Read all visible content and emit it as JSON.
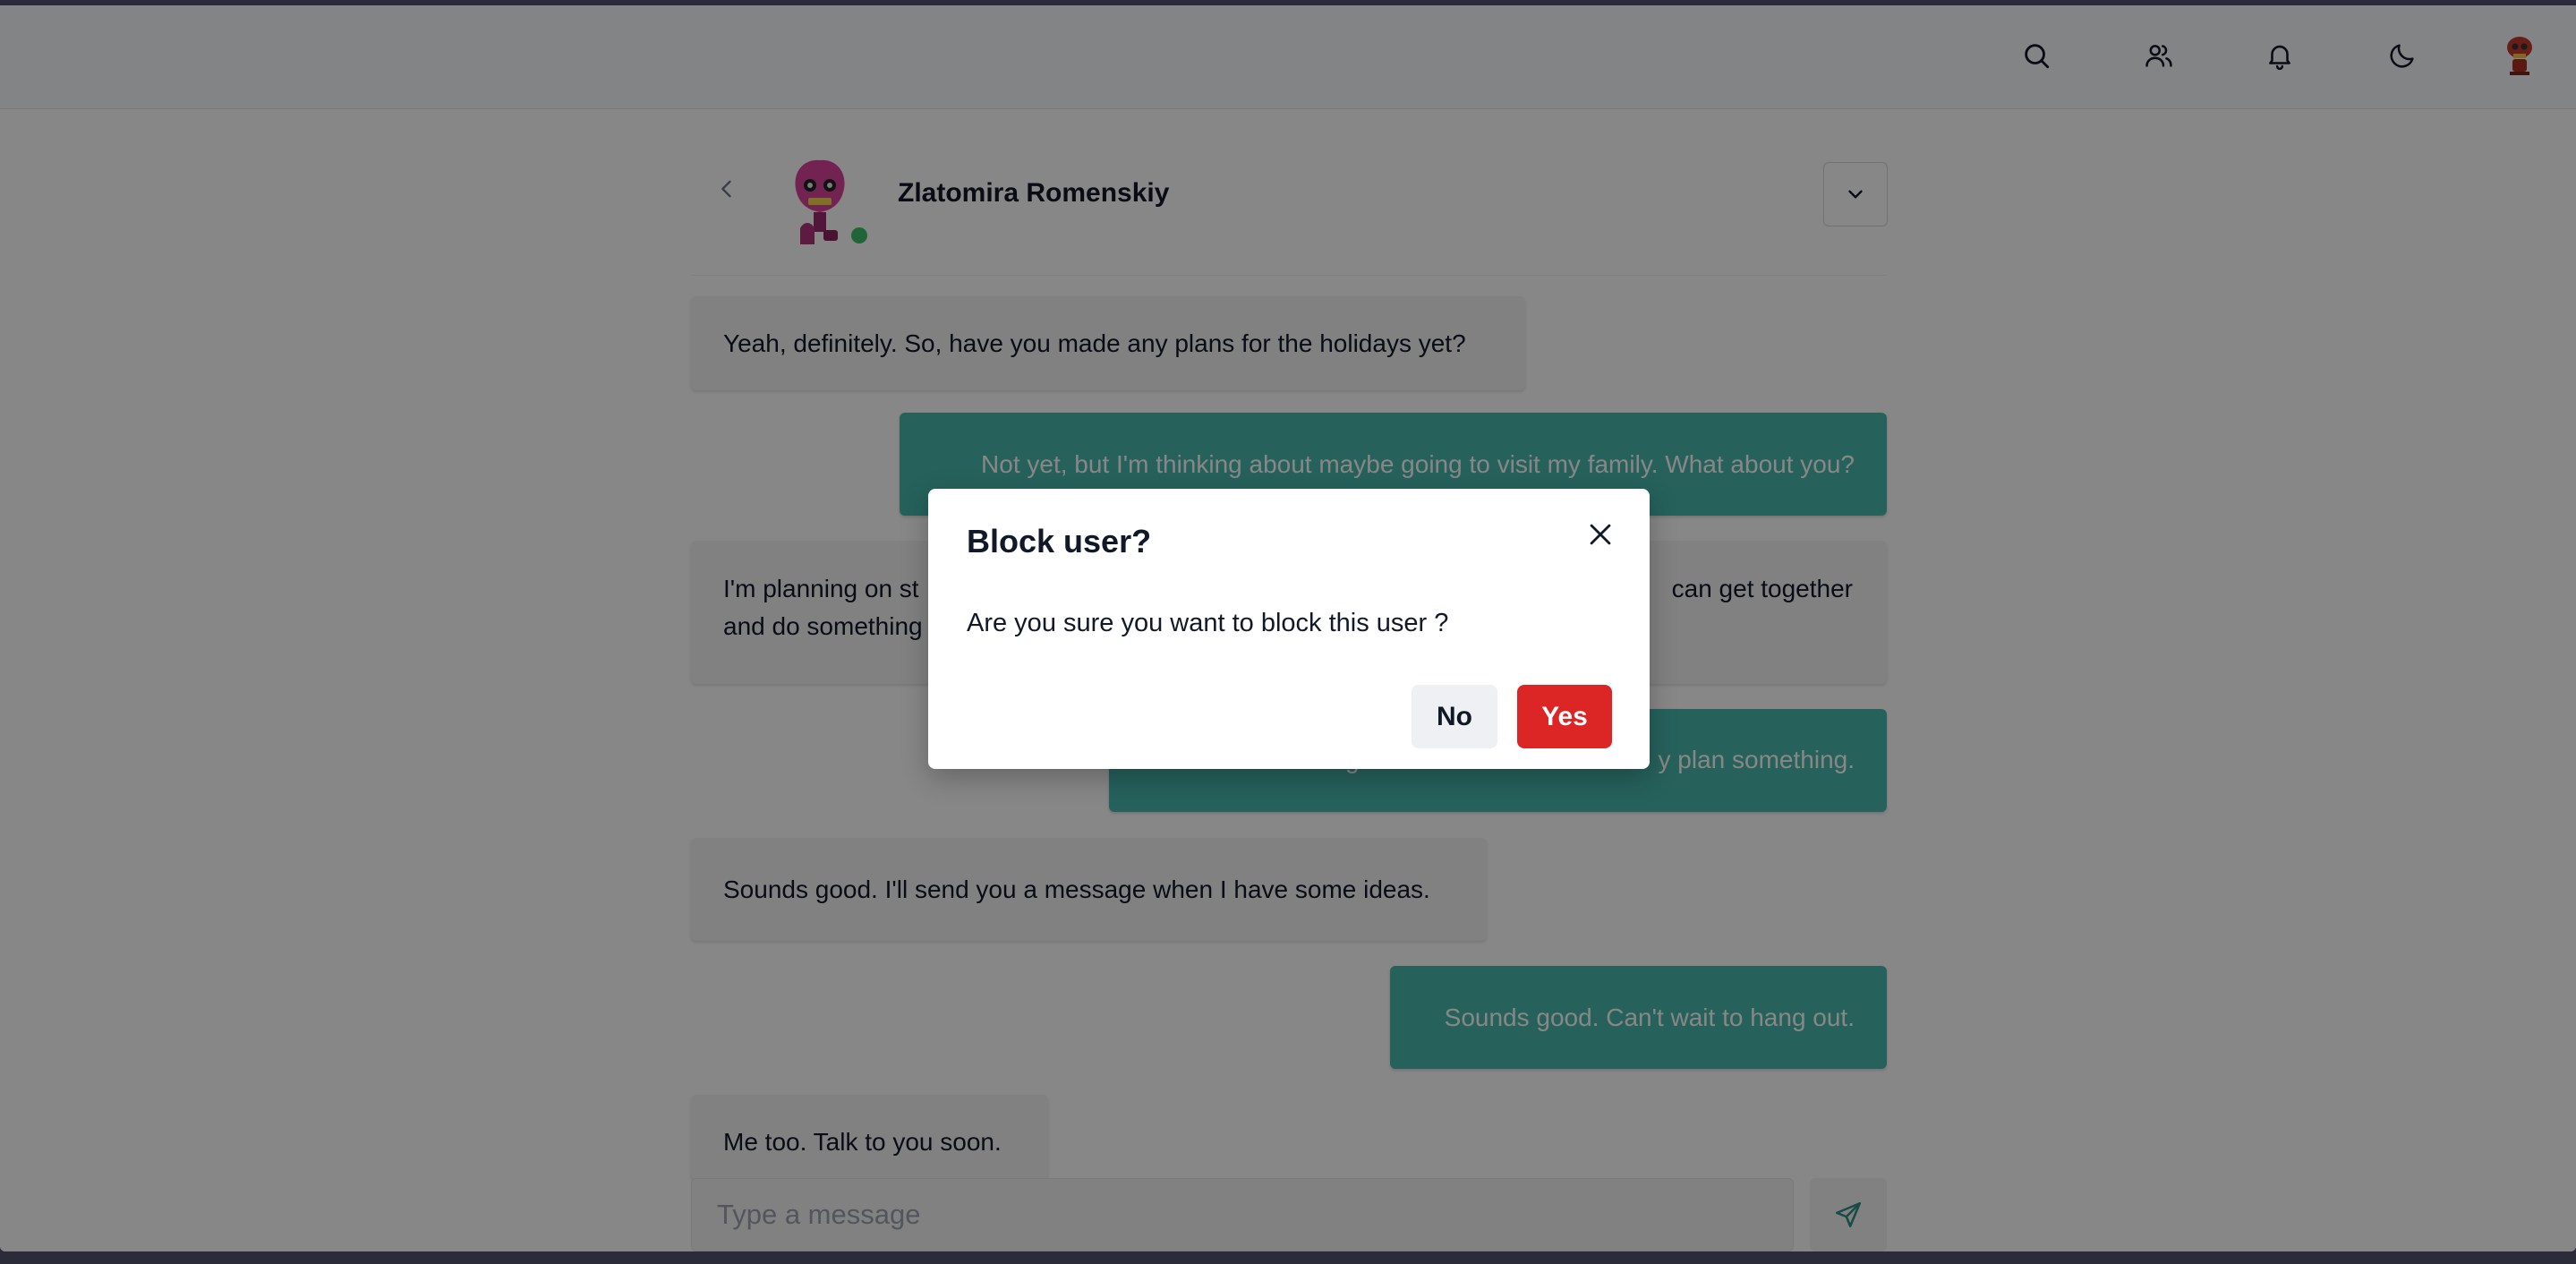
{
  "topbar": {
    "icons": [
      "search-icon",
      "users-icon",
      "bell-icon",
      "moon-icon"
    ],
    "user_avatar": "user-avatar"
  },
  "chat": {
    "contact_name": "Zlatomira Romenskiy",
    "status": "online",
    "messages": [
      {
        "from": "them",
        "text": "Yeah, definitely. So, have you made any plans for the holidays yet?"
      },
      {
        "from": "me",
        "text": "Not yet, but I'm thinking about maybe going to visit my family. What about you?"
      },
      {
        "from": "them",
        "text": "I'm planning on st… can get together and do something…"
      },
      {
        "from": "me",
        "text": "…g… …y plan something."
      },
      {
        "from": "them",
        "text": "Sounds good. I'll send you a message when I have some ideas."
      },
      {
        "from": "me",
        "text": "Sounds good. Can't wait to hang out."
      },
      {
        "from": "them",
        "text": "Me too. Talk to you soon."
      }
    ],
    "visible_fragments": {
      "msg3_line1_left": "I'm planning on st",
      "msg3_line1_right": "can get together",
      "msg3_line2_left": "and do something",
      "msg4_right": "y plan something.",
      "msg4_mid": "g"
    },
    "composer_placeholder": "Type a message"
  },
  "modal": {
    "title": "Block user?",
    "body": "Are you sure you want to block this user ?",
    "no_label": "No",
    "yes_label": "Yes"
  },
  "colors": {
    "outgoing_bubble": "#49b8ae",
    "incoming_bubble": "#f3f4f6",
    "danger": "#dc2626",
    "online": "#3bbf6a"
  }
}
